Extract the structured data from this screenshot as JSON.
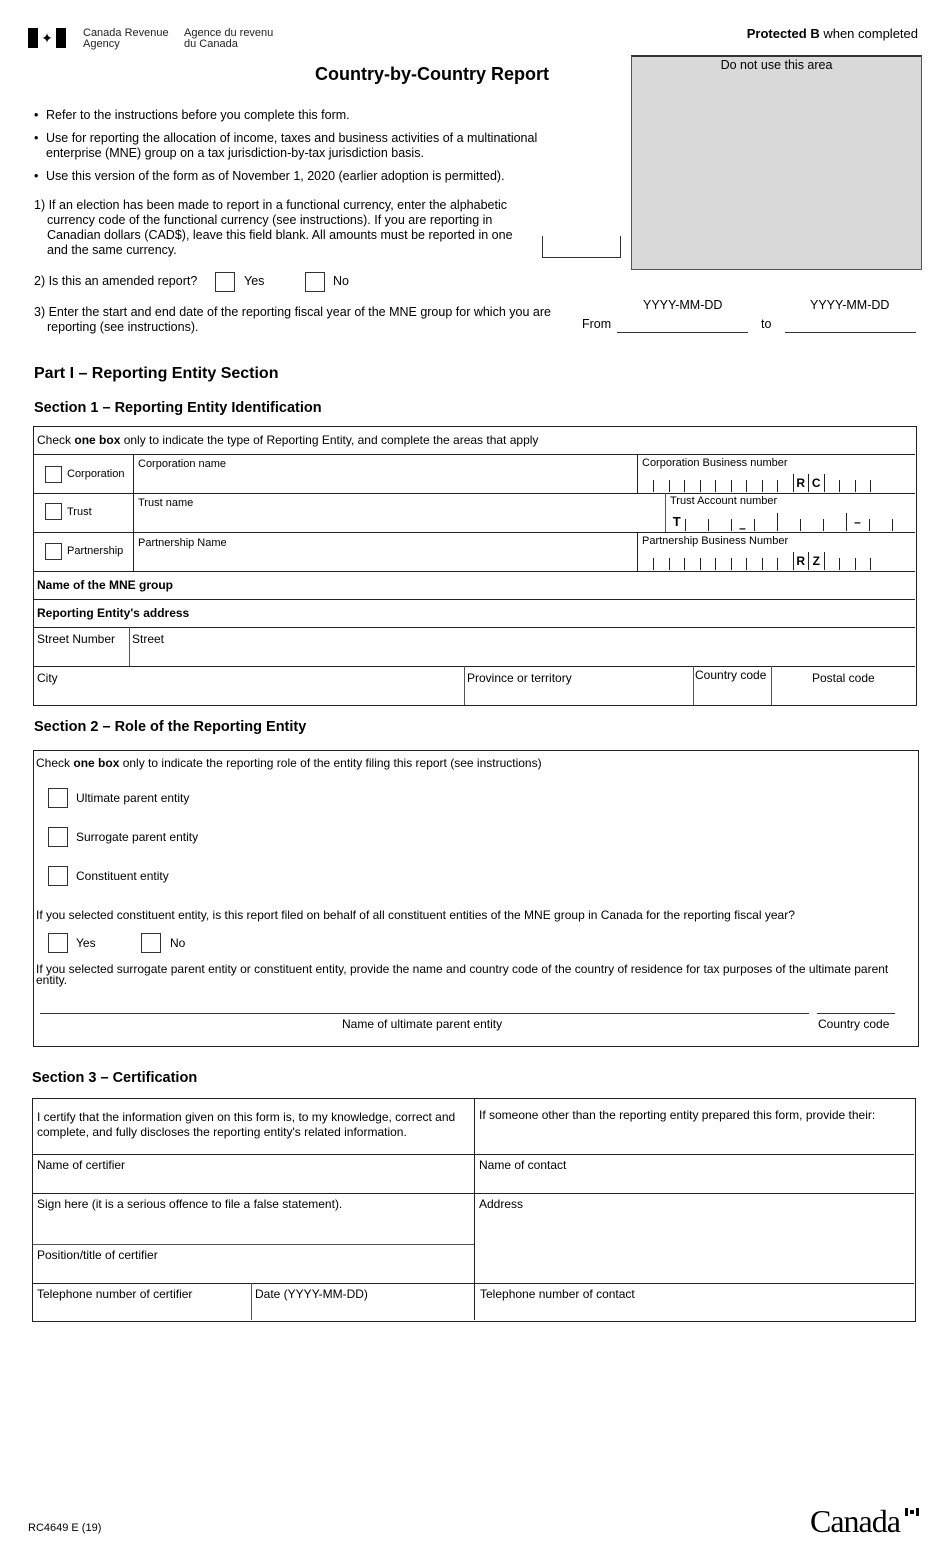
{
  "header": {
    "agency_en_line1": "Canada Revenue",
    "agency_en_line2": "Agency",
    "agency_fr_line1": "Agence du revenu",
    "agency_fr_line2": "du Canada",
    "protected_bold": "Protected B",
    "protected_rest": " when completed",
    "title": "Country-by-Country Report",
    "do_not_use": "Do not use this area",
    "flag_icon": "maple-leaf"
  },
  "intro": {
    "bullets": [
      "Refer to the instructions before you complete this form.",
      "Use for reporting the allocation of income, taxes and business activities of a multinational enterprise (MNE) group on a tax jurisdiction-by-tax jurisdiction basis.",
      "Use this version of the form as of November 1, 2020 (earlier adoption is permitted)."
    ],
    "q1": "1) If an election has been made to report in a functional currency, enter the alphabetic currency code of the functional currency (see instructions). If you are reporting in Canadian dollars (CAD$), leave this field blank. All amounts must be reported in one and the same currency.",
    "q1_value": "",
    "q2": "2) Is this an amended report?",
    "q2_yes": "Yes",
    "q2_no": "No",
    "q3": "3) Enter the start and end date of the reporting fiscal year of the MNE group for which you are reporting (see instructions).",
    "date_format": "YYYY-MM-DD",
    "from_label": "From",
    "to_label": "to",
    "from_value": "",
    "to_value": ""
  },
  "part1": {
    "title": "Part I – Reporting Entity Section",
    "section1": {
      "title": "Section 1 – Reporting Entity Identification",
      "instruction_pre": "Check ",
      "instruction_bold": "one box",
      "instruction_post": " only to indicate the type of Reporting Entity, and complete the areas that apply",
      "corporation": "Corporation",
      "corporation_name": "Corporation name",
      "corporation_bn": "Corporation Business number",
      "corp_suffix": [
        "R",
        "C"
      ],
      "trust": "Trust",
      "trust_name": "Trust name",
      "trust_account": "Trust Account number",
      "trust_prefix": "T",
      "dash": "–",
      "partnership": "Partnership",
      "partnership_name": "Partnership Name",
      "partnership_bn": "Partnership Business Number",
      "part_suffix": [
        "R",
        "Z"
      ],
      "mne_group": "Name of the MNE group",
      "address_heading": "Reporting Entity's address",
      "street_number": "Street Number",
      "street": "Street",
      "city": "City",
      "province": "Province or territory",
      "country_code": "Country code",
      "postal_code": "Postal code"
    },
    "section2": {
      "title": "Section 2 – Role of the Reporting Entity",
      "instruction_pre": "Check ",
      "instruction_bold": "one box",
      "instruction_post": " only to indicate the reporting role of the entity filing this report (see instructions)",
      "options": [
        "Ultimate parent entity",
        "Surrogate parent entity",
        "Constituent entity"
      ],
      "constituent_q": "If you selected constituent entity, is this report filed on behalf of all constituent entities of the MNE group in Canada for the reporting fiscal year?",
      "yes": "Yes",
      "no": "No",
      "surrogate_q": "If you selected surrogate parent entity or constituent entity, provide the name and country code of the country of residence for tax purposes of the ultimate parent entity.",
      "upe_name_label": "Name of ultimate parent entity",
      "country_code_label": "Country code"
    },
    "section3": {
      "title": "Section 3 – Certification",
      "certify": "I certify that the information given on this form is, to my knowledge, correct and complete, and fully discloses the reporting entity's related information.",
      "someone_else": "If someone other than the reporting entity prepared this form, provide their:",
      "name_certifier": "Name of certifier",
      "name_contact": "Name of contact",
      "sign_here": "Sign here (it is a serious offence to file a false statement).",
      "address": "Address",
      "position": "Position/title of certifier",
      "tel_certifier": "Telephone number of certifier",
      "date": "Date (YYYY-MM-DD)",
      "tel_contact": "Telephone number of contact"
    }
  },
  "footer": {
    "form_code": "RC4649 E (19)",
    "wordmark": "Canada"
  }
}
